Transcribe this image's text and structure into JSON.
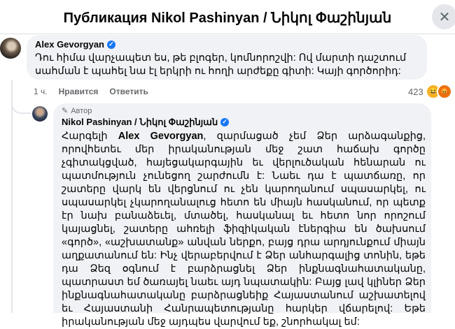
{
  "header": {
    "title": "Публикация Nikol Pashinyan / Նիկոլ Փաշինյան",
    "close_icon": "✕"
  },
  "comment": {
    "author": "Alex Gevorgyan",
    "text": "Դու հիմա վարչապետ ես, թե բլոգեր, կոմնորոշվի: Ով մարտի դաշտում սահման է պահել նա էլ երկրի ու հողի արժեքը գիտի: Կայի գործորիդ:",
    "time": "1 ч.",
    "like_label": "Нравится",
    "reply_label": "Ответить",
    "reactions_count": "423"
  },
  "reply": {
    "badge": "Автор",
    "author": "Nikol Pashinyan / Նիկոլ Փաշինյան",
    "greeting": "Հարգելի ",
    "mention": "Alex Gevorgyan",
    "text": ", զարմացած չեմ Ձեր արձագանքից, որովհետեւ մեր իրականության մեջ շատ հաճախ գործը չգիտակցված, հայեցակարգային եւ վերլուծական հենարան ու պատմություն չունեցող շարժումն է: Նաեւ դա է պատճառը, որ շատերը վարկ են վերցնում ու չեն կարողանում սպասարկել, ու սպասարկել չկարողանալուց հետո են միայն հասկանում, որ պետք էր նախ բանաձեւել, մտածել, հասկանալ եւ հետո նոր որոշում կայացնել, շատերը ահռելի ֆիզիկական էներգիա են ծախսում «գործ», «աշխատանք» անվան ներքո, բայց դրա արդյունքում միայն աղքատանում են: Ինչ վերաբերվում է Ձեր անհարգալից տոնին, եթե դա Ձեզ օգնում է բարձրացնել Ձեր ինքնագնահատականը, պատրաստ եմ ծառայել նաեւ այդ նպատակին: Բայց լավ կլիներ Ձեր ինքնագնահատականը բարձրացնեիք Հայաստանում աշխատելով եւ Հայաստանի Հանրապետությանը հարկեր վճարելով: Եթե իրականության մեջ այդպես վարվում եք, շնորհակալ եմ:"
  }
}
